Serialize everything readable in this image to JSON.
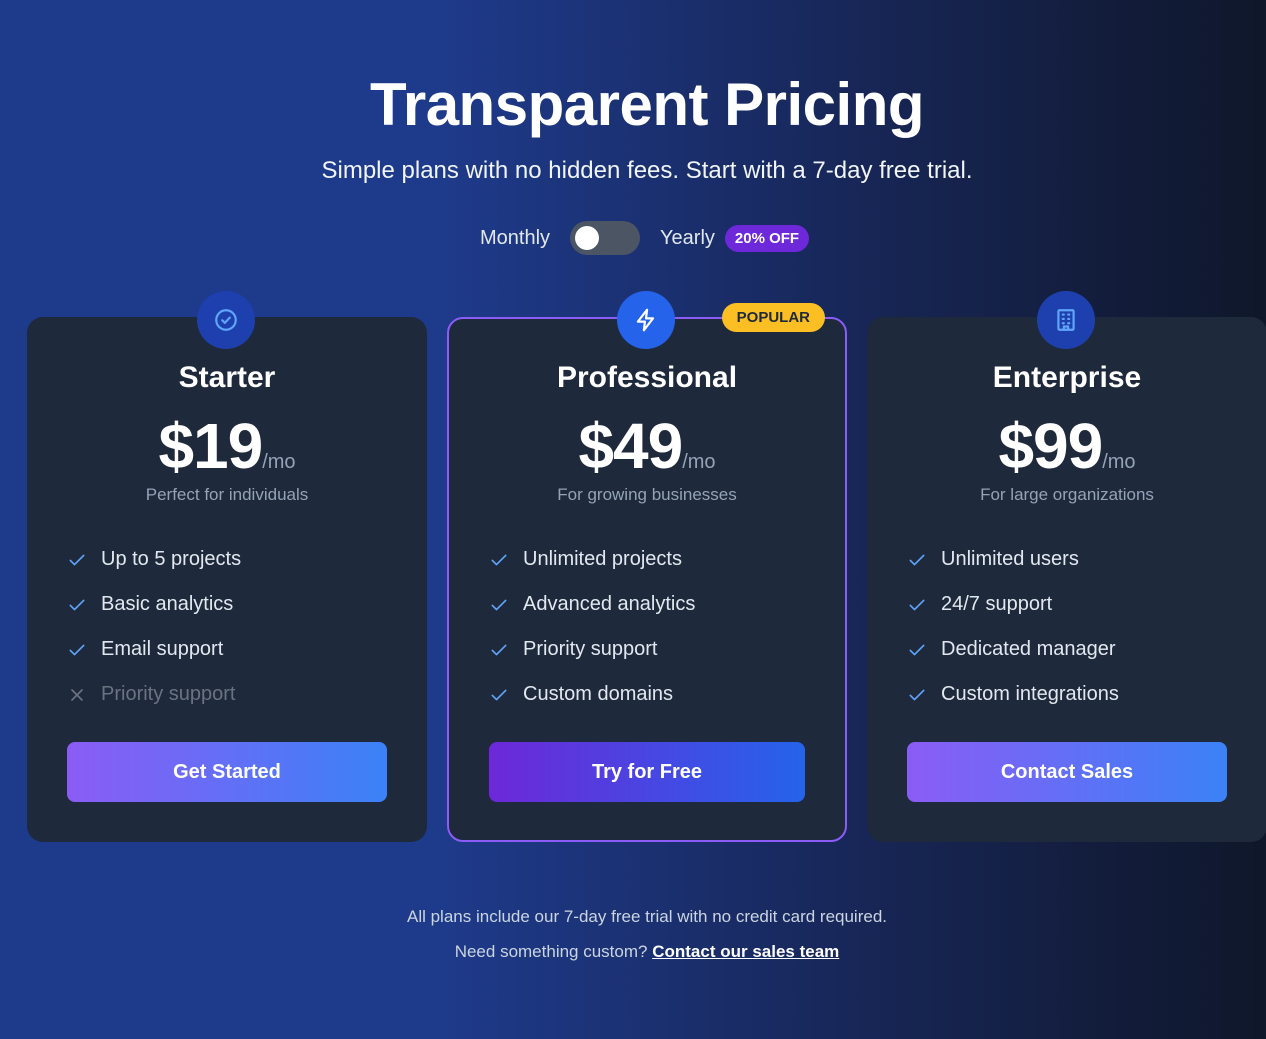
{
  "header": {
    "title": "Transparent Pricing",
    "subtitle": "Simple plans with no hidden fees. Start with a 7-day free trial."
  },
  "billing": {
    "monthly_label": "Monthly",
    "yearly_label": "Yearly",
    "discount_badge": "20% OFF",
    "yearly_selected": false
  },
  "plans": [
    {
      "icon": "check-circle-icon",
      "name": "Starter",
      "price": "$19",
      "period": "/mo",
      "description": "Perfect for individuals",
      "features": [
        {
          "text": "Up to 5 projects",
          "included": true
        },
        {
          "text": "Basic analytics",
          "included": true
        },
        {
          "text": "Email support",
          "included": true
        },
        {
          "text": "Priority support",
          "included": false
        }
      ],
      "cta": "Get Started"
    },
    {
      "icon": "lightning-icon",
      "name": "Professional",
      "price": "$49",
      "period": "/mo",
      "description": "For growing businesses",
      "badge": "POPULAR",
      "features": [
        {
          "text": "Unlimited projects",
          "included": true
        },
        {
          "text": "Advanced analytics",
          "included": true
        },
        {
          "text": "Priority support",
          "included": true
        },
        {
          "text": "Custom domains",
          "included": true
        }
      ],
      "cta": "Try for Free"
    },
    {
      "icon": "building-icon",
      "name": "Enterprise",
      "price": "$99",
      "period": "/mo",
      "description": "For large organizations",
      "features": [
        {
          "text": "Unlimited users",
          "included": true
        },
        {
          "text": "24/7 support",
          "included": true
        },
        {
          "text": "Dedicated manager",
          "included": true
        },
        {
          "text": "Custom integrations",
          "included": true
        }
      ],
      "cta": "Contact Sales"
    }
  ],
  "colors": {
    "accent_purple": "#8b5cf6",
    "accent_blue": "#3b82f6",
    "popular_badge": "#fbbf24",
    "card_bg": "#1e293b"
  },
  "footer": {
    "note": "All plans include our 7-day free trial with no credit card required.",
    "custom_prefix": "Need something custom?",
    "custom_link": "Contact our sales team"
  }
}
